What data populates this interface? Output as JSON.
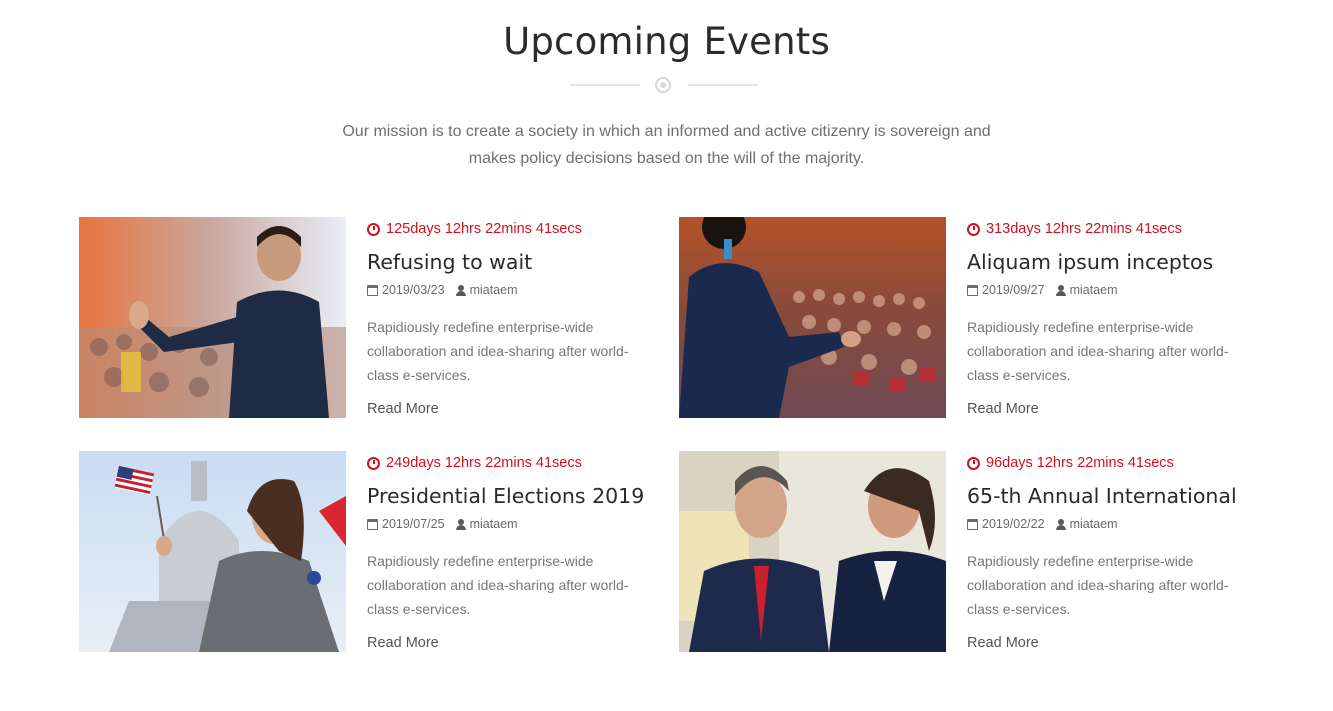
{
  "section": {
    "title": "Upcoming Events",
    "subtitle": "Our mission is to create a society in which an informed and active citizenry is sovereign and makes policy decisions based on the will of the majority."
  },
  "events": [
    {
      "countdown": "125days 12hrs 22mins 41secs",
      "title": "Refusing to wait",
      "date": "2019/03/23",
      "author": "miataem",
      "description": "Rapidiously redefine enterprise-wide collaboration and idea-sharing after world-class e-services.",
      "read_more": "Read More",
      "image_alt": "speaker-addressing-audience-photo"
    },
    {
      "countdown": "313days 12hrs 22mins 41secs",
      "title": "Aliquam ipsum inceptos",
      "date": "2019/09/27",
      "author": "miataem",
      "description": "Rapidiously redefine enterprise-wide collaboration and idea-sharing after world-class e-services.",
      "read_more": "Read More",
      "image_alt": "conference-hall-speaker-photo"
    },
    {
      "countdown": "249days 12hrs 22mins 41secs",
      "title": "Presidential Elections 2019",
      "date": "2019/07/25",
      "author": "miataem",
      "description": "Rapidiously redefine enterprise-wide collaboration and idea-sharing after world-class e-services.",
      "read_more": "Read More",
      "image_alt": "woman-with-flag-and-megaphone-photo"
    },
    {
      "countdown": "96days 12hrs 22mins 41secs",
      "title": "65-th Annual International",
      "date": "2019/02/22",
      "author": "miataem",
      "description": "Rapidiously redefine enterprise-wide collaboration and idea-sharing after world-class e-services.",
      "read_more": "Read More",
      "image_alt": "business-meeting-photo"
    }
  ]
}
